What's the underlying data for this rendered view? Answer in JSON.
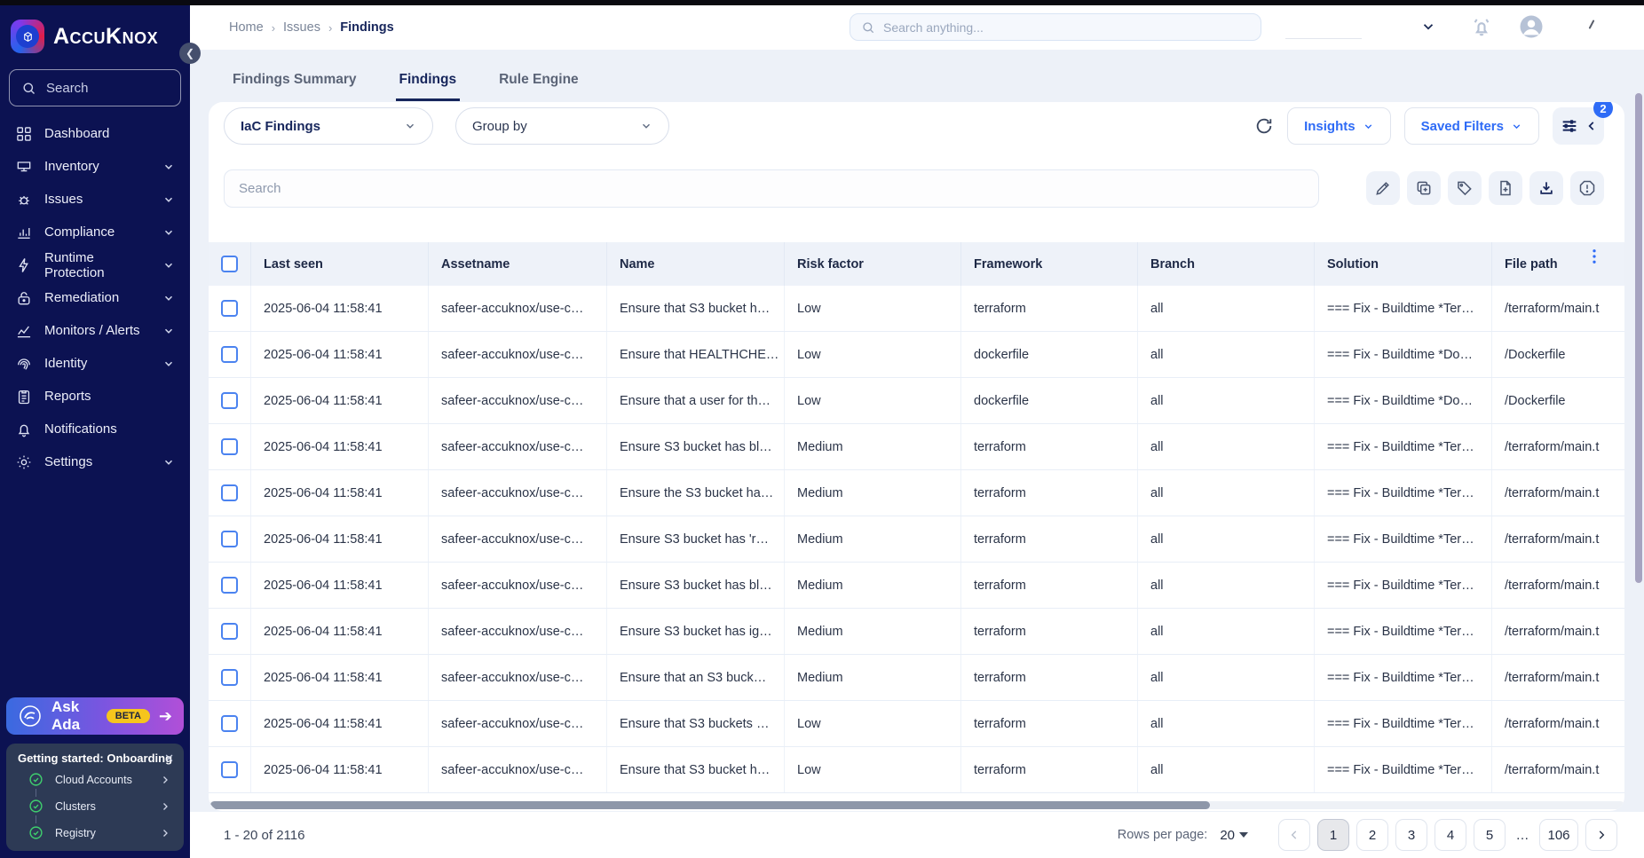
{
  "brand": {
    "name": "AccuKnox"
  },
  "sidebar": {
    "search_placeholder": "Search",
    "items": [
      {
        "label": "Dashboard",
        "icon": "dashboard-icon",
        "expandable": false
      },
      {
        "label": "Inventory",
        "icon": "inventory-icon",
        "expandable": true
      },
      {
        "label": "Issues",
        "icon": "issues-icon",
        "expandable": true
      },
      {
        "label": "Compliance",
        "icon": "compliance-icon",
        "expandable": true
      },
      {
        "label": "Runtime Protection",
        "icon": "runtime-protection-icon",
        "expandable": true
      },
      {
        "label": "Remediation",
        "icon": "remediation-icon",
        "expandable": true
      },
      {
        "label": "Monitors / Alerts",
        "icon": "monitors-alerts-icon",
        "expandable": true
      },
      {
        "label": "Identity",
        "icon": "identity-icon",
        "expandable": true
      },
      {
        "label": "Reports",
        "icon": "reports-icon",
        "expandable": false
      },
      {
        "label": "Notifications",
        "icon": "notifications-icon",
        "expandable": false
      },
      {
        "label": "Settings",
        "icon": "settings-icon",
        "expandable": true
      }
    ],
    "ask_ada": {
      "label": "Ask Ada",
      "badge": "BETA"
    },
    "onboarding": {
      "title": "Getting started: Onboarding",
      "items": [
        {
          "label": "Cloud Accounts"
        },
        {
          "label": "Clusters"
        },
        {
          "label": "Registry"
        }
      ]
    }
  },
  "topbar": {
    "breadcrumbs": [
      "Home",
      "Issues",
      "Findings"
    ],
    "search_placeholder": "Search anything..."
  },
  "tabs": {
    "items": [
      "Findings Summary",
      "Findings",
      "Rule Engine"
    ],
    "active": "Findings"
  },
  "filters": {
    "finding_type": "IaC Findings",
    "group_by": "Group by",
    "insights_label": "Insights",
    "saved_filters_label": "Saved Filters",
    "active_filter_count": "2"
  },
  "toolbar": {
    "search_placeholder": "Search"
  },
  "table": {
    "columns": [
      "Last seen",
      "Assetname",
      "Name",
      "Risk factor",
      "Framework",
      "Branch",
      "Solution",
      "File path"
    ],
    "rows": [
      {
        "last_seen": "2025-06-04 11:58:41",
        "assetname": "safeer-accuknox/use-c…",
        "name": "Ensure that S3 bucket h…",
        "risk_factor": "Low",
        "framework": "terraform",
        "branch": "all",
        "solution": "=== Fix - Buildtime *Ter…",
        "file_path": "/terraform/main.t"
      },
      {
        "last_seen": "2025-06-04 11:58:41",
        "assetname": "safeer-accuknox/use-c…",
        "name": "Ensure that HEALTHCHE…",
        "risk_factor": "Low",
        "framework": "dockerfile",
        "branch": "all",
        "solution": "=== Fix - Buildtime *Do…",
        "file_path": "/Dockerfile"
      },
      {
        "last_seen": "2025-06-04 11:58:41",
        "assetname": "safeer-accuknox/use-c…",
        "name": "Ensure that a user for th…",
        "risk_factor": "Low",
        "framework": "dockerfile",
        "branch": "all",
        "solution": "=== Fix - Buildtime *Do…",
        "file_path": "/Dockerfile"
      },
      {
        "last_seen": "2025-06-04 11:58:41",
        "assetname": "safeer-accuknox/use-c…",
        "name": "Ensure S3 bucket has bl…",
        "risk_factor": "Medium",
        "framework": "terraform",
        "branch": "all",
        "solution": "=== Fix - Buildtime *Ter…",
        "file_path": "/terraform/main.t"
      },
      {
        "last_seen": "2025-06-04 11:58:41",
        "assetname": "safeer-accuknox/use-c…",
        "name": "Ensure the S3 bucket ha…",
        "risk_factor": "Medium",
        "framework": "terraform",
        "branch": "all",
        "solution": "=== Fix - Buildtime *Ter…",
        "file_path": "/terraform/main.t"
      },
      {
        "last_seen": "2025-06-04 11:58:41",
        "assetname": "safeer-accuknox/use-c…",
        "name": "Ensure S3 bucket has 'r…",
        "risk_factor": "Medium",
        "framework": "terraform",
        "branch": "all",
        "solution": "=== Fix - Buildtime *Ter…",
        "file_path": "/terraform/main.t"
      },
      {
        "last_seen": "2025-06-04 11:58:41",
        "assetname": "safeer-accuknox/use-c…",
        "name": "Ensure S3 bucket has bl…",
        "risk_factor": "Medium",
        "framework": "terraform",
        "branch": "all",
        "solution": "=== Fix - Buildtime *Ter…",
        "file_path": "/terraform/main.t"
      },
      {
        "last_seen": "2025-06-04 11:58:41",
        "assetname": "safeer-accuknox/use-c…",
        "name": "Ensure S3 bucket has ig…",
        "risk_factor": "Medium",
        "framework": "terraform",
        "branch": "all",
        "solution": "=== Fix - Buildtime *Ter…",
        "file_path": "/terraform/main.t"
      },
      {
        "last_seen": "2025-06-04 11:58:41",
        "assetname": "safeer-accuknox/use-c…",
        "name": "Ensure that an S3 buck…",
        "risk_factor": "Medium",
        "framework": "terraform",
        "branch": "all",
        "solution": "=== Fix - Buildtime *Ter…",
        "file_path": "/terraform/main.t"
      },
      {
        "last_seen": "2025-06-04 11:58:41",
        "assetname": "safeer-accuknox/use-c…",
        "name": "Ensure that S3 buckets …",
        "risk_factor": "Low",
        "framework": "terraform",
        "branch": "all",
        "solution": "=== Fix - Buildtime *Ter…",
        "file_path": "/terraform/main.t"
      },
      {
        "last_seen": "2025-06-04 11:58:41",
        "assetname": "safeer-accuknox/use-c…",
        "name": "Ensure that S3 bucket h…",
        "risk_factor": "Low",
        "framework": "terraform",
        "branch": "all",
        "solution": "=== Fix - Buildtime *Ter…",
        "file_path": "/terraform/main.t"
      }
    ]
  },
  "footer": {
    "range": "1 - 20 of 2116",
    "rows_per_page_label": "Rows per page:",
    "rows_per_page": "20",
    "pages": [
      "1",
      "2",
      "3",
      "4",
      "5",
      "…",
      "106"
    ],
    "active_page": "1"
  },
  "colors": {
    "accent_blue": "#2e6bf6",
    "sidebar_bg": "#0c1252",
    "badge_yellow": "#f6c51d",
    "success_green": "#3fcf6e",
    "header_bg": "#eef2f9"
  }
}
